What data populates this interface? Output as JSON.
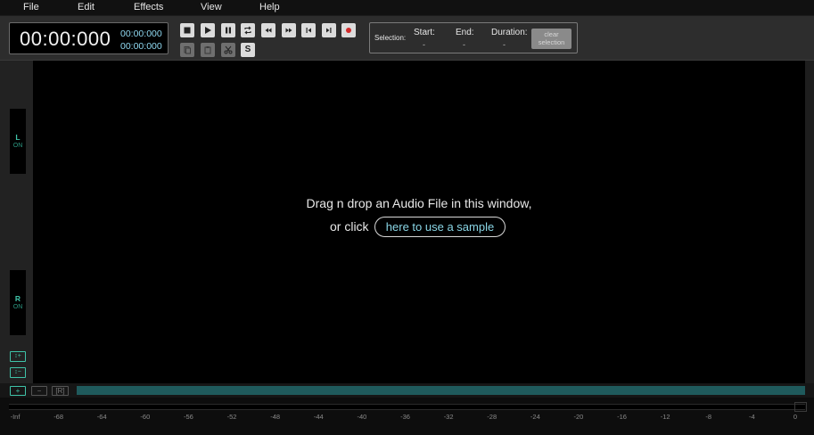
{
  "menu": [
    "File",
    "Edit",
    "Effects",
    "View",
    "Help"
  ],
  "time": {
    "main": "00:00:000",
    "start": "00:00:000",
    "end": "00:00:000"
  },
  "transport_icons": [
    "stop-icon",
    "play-icon",
    "pause-icon",
    "loop-icon",
    "rewind-icon",
    "fast-forward-icon",
    "skip-to-start-icon",
    "skip-to-end-icon",
    "record-icon"
  ],
  "edit_icons": [
    "copy-icon",
    "paste-icon",
    "cut-icon",
    "silence-icon"
  ],
  "edit_silence_label": "S",
  "selection": {
    "label": "Selection:",
    "start_label": "Start:",
    "start_value": "-",
    "end_label": "End:",
    "end_value": "-",
    "duration_label": "Duration:",
    "duration_value": "-",
    "clear_label": "clear selection"
  },
  "channels": [
    {
      "name": "L",
      "state": "ON"
    },
    {
      "name": "R",
      "state": "ON"
    }
  ],
  "side_buttons": {
    "zoom_in_v": "↕+",
    "zoom_out_v": "↕−"
  },
  "drop": {
    "line1": "Drag n drop an Audio File in this window,",
    "or_click": "or click",
    "sample_link": "here to use a sample"
  },
  "zoom_buttons": {
    "zoom_in": "+",
    "zoom_out": "−",
    "zoom_reset": "[R]"
  },
  "meter_ticks": [
    "-Inf",
    "-68",
    "-64",
    "-60",
    "-56",
    "-52",
    "-48",
    "-44",
    "-40",
    "-36",
    "-32",
    "-28",
    "-24",
    "-20",
    "-16",
    "-12",
    "-8",
    "-4",
    "0"
  ],
  "colors": {
    "accent": "#3fc3a8",
    "link": "#8ad6e6",
    "overview": "#1f5a5c",
    "record": "#d22a2a"
  }
}
